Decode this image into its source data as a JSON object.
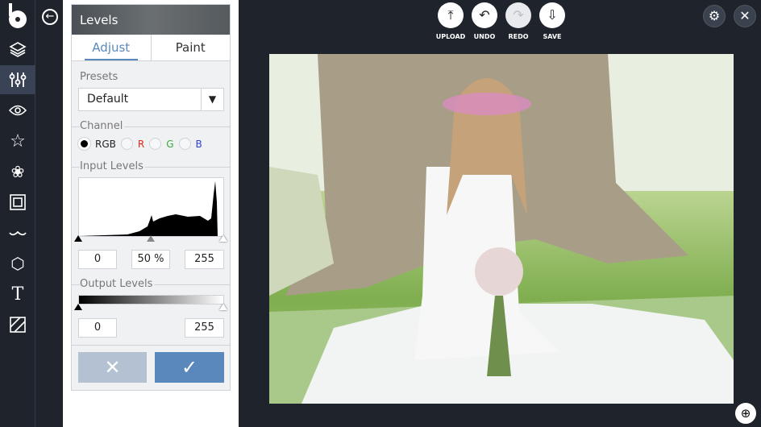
{
  "sidebar": {
    "items": [
      "logo",
      "layers",
      "adjust",
      "eye",
      "star",
      "flower",
      "frame",
      "mustache",
      "badge",
      "text",
      "texture"
    ],
    "active": "adjust"
  },
  "panel": {
    "title": "Levels",
    "tabs": [
      "Adjust",
      "Paint"
    ],
    "presets_label": "Presets",
    "preset_value": "Default",
    "channel_label": "Channel",
    "channels": [
      "RGB",
      "R",
      "G",
      "B"
    ],
    "channel_selected": "RGB",
    "input_label": "Input Levels",
    "input_values": [
      "0",
      "50 %",
      "255"
    ],
    "output_label": "Output Levels",
    "output_values": [
      "0",
      "255"
    ]
  },
  "toolbar": {
    "upload": "UPLOAD",
    "undo": "UNDO",
    "redo": "REDO",
    "save": "SAVE"
  },
  "colors": {
    "accent": "#5a88bd",
    "cancel": "#b3c1d3",
    "bg": "#1e232c"
  }
}
